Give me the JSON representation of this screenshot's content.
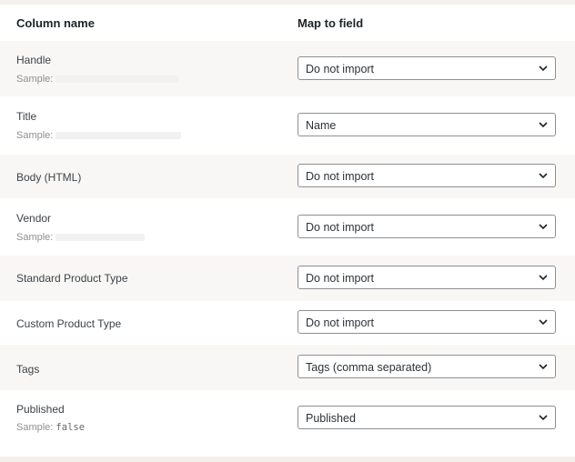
{
  "header": {
    "column_name": "Column name",
    "map_to_field": "Map to field"
  },
  "sample_prefix": "Sample:",
  "rows": [
    {
      "label": "Handle",
      "sample": "",
      "selected": "Do not import"
    },
    {
      "label": "Title",
      "sample": "",
      "selected": "Name"
    },
    {
      "label": "Body (HTML)",
      "sample": "",
      "selected": "Do not import"
    },
    {
      "label": "Vendor",
      "sample": "",
      "selected": "Do not import"
    },
    {
      "label": "Standard Product Type",
      "sample": "",
      "selected": "Do not import"
    },
    {
      "label": "Custom Product Type",
      "sample": "",
      "selected": "Do not import"
    },
    {
      "label": "Tags",
      "sample": "",
      "selected": "Tags (comma separated)"
    },
    {
      "label": "Published",
      "sample": "false",
      "selected": "Published"
    }
  ],
  "icons": {
    "dropdown": "chevron-down-icon"
  },
  "colors": {
    "row_alt": "#f9f7f5",
    "select_border": "#8c8f94"
  }
}
